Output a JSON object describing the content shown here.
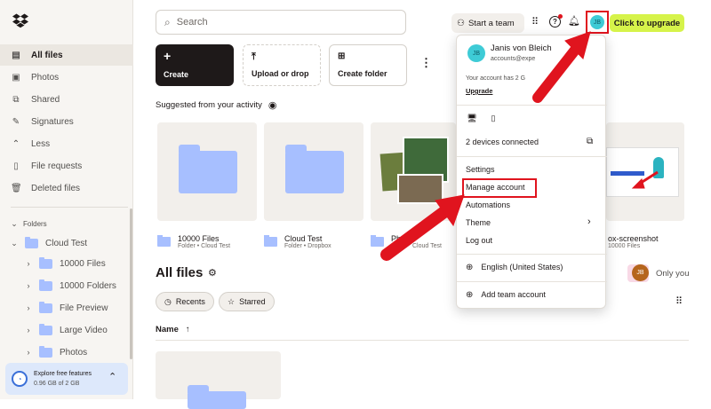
{
  "sidebar": {
    "nav": [
      {
        "icon": "files-icon",
        "label": "All files"
      },
      {
        "icon": "photos-icon",
        "label": "Photos"
      },
      {
        "icon": "shared-icon",
        "label": "Shared"
      },
      {
        "icon": "signatures-icon",
        "label": "Signatures"
      },
      {
        "icon": "less-icon",
        "label": "Less"
      },
      {
        "icon": "file-requests-icon",
        "label": "File requests"
      },
      {
        "icon": "deleted-files-icon",
        "label": "Deleted files"
      }
    ],
    "folders_heading": "Folders",
    "tree": {
      "root": "Cloud Test",
      "children": [
        "10000 Files",
        "10000 Folders",
        "File Preview",
        "Large Video",
        "Photos"
      ]
    },
    "storage": {
      "title": "Explore free features",
      "usage": "0.96 GB of 2 GB"
    }
  },
  "header": {
    "search_placeholder": "Search",
    "start_team": "Start a team",
    "avatar_initials": "JB",
    "upgrade": "Click to upgrade"
  },
  "actions": {
    "create": "Create",
    "upload": "Upload or drop",
    "create_folder": "Create folder"
  },
  "suggested": {
    "heading": "Suggested from your activity",
    "items": [
      {
        "name": "10000 Files",
        "meta": "Folder • Cloud Test"
      },
      {
        "name": "Cloud Test",
        "meta": "Folder • Dropbox"
      },
      {
        "name": "Pho",
        "meta": "Cloud Test"
      },
      {
        "name": "ox-screenshot",
        "meta": "10000 Files"
      }
    ]
  },
  "all_files": {
    "heading": "All files",
    "filters": [
      "Recents",
      "Starred"
    ],
    "only_you": "Only you",
    "sort_label": "Name"
  },
  "account_menu": {
    "name": "Janis von Bleich",
    "email": "accounts@expe",
    "plan": "Your account has 2 G",
    "upgrade": "Upgrade",
    "devices": "2 devices connected",
    "items": [
      "Settings",
      "Manage account",
      "Automations",
      "Theme",
      "Log out"
    ],
    "language": "English (United States)",
    "add_team": "Add team account"
  },
  "colors": {
    "accent": "#d6f34a",
    "highlight": "#e0141e",
    "folder": "#a7bfff",
    "avatar": "#3ecbd6"
  }
}
